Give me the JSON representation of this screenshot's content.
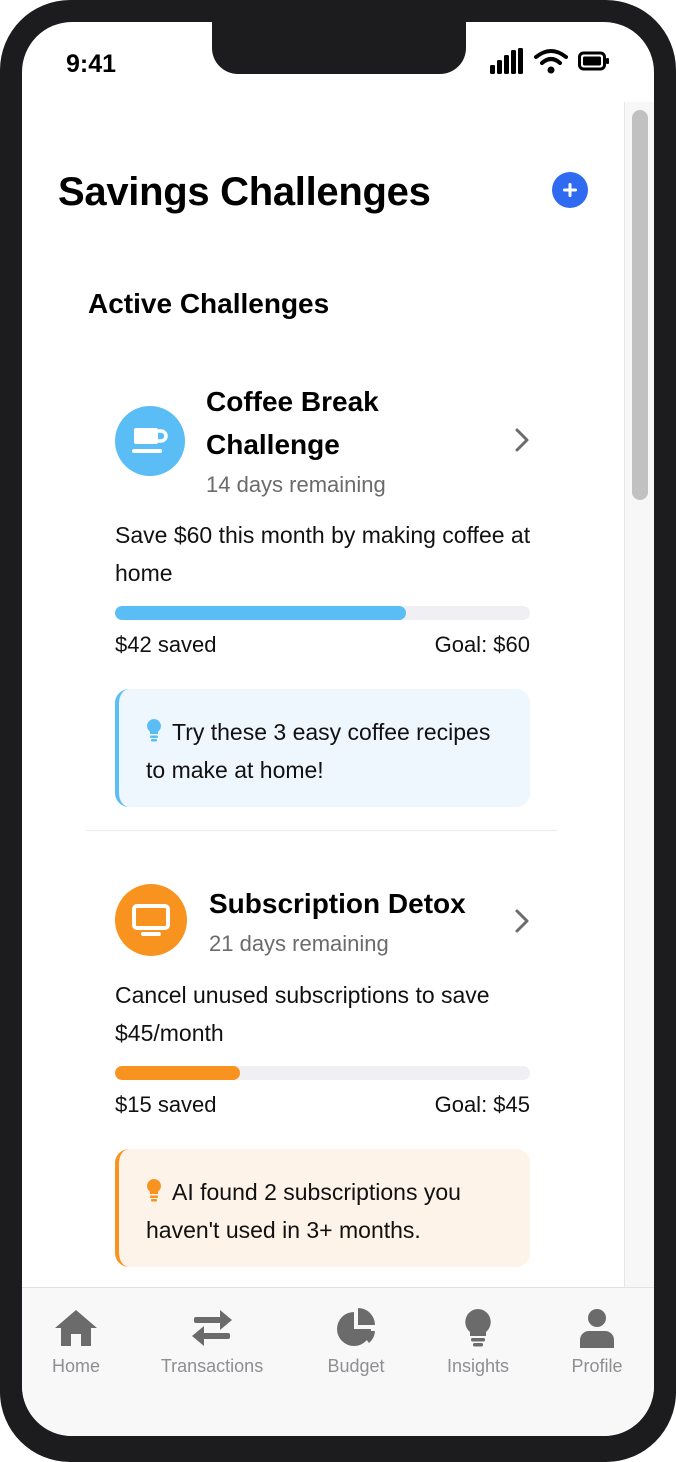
{
  "status_bar": {
    "time": "9:41"
  },
  "page": {
    "title": "Savings Challenges"
  },
  "section": {
    "title": "Active Challenges"
  },
  "challenges": [
    {
      "title_line1": "Coffee Break",
      "title_line2": "Challenge",
      "remaining": "14 days remaining",
      "description": "Save $60 this month by making coffee at home",
      "progress": 0.7,
      "saved": "$42 saved",
      "goal": "Goal: $60",
      "tip": "Try these 3 easy coffee recipes to make at home!",
      "icon": "coffee-cup-icon",
      "accent": "#5bbdf5",
      "tip_bg": "#eef6fe"
    },
    {
      "title_line1": "Subscription Detox",
      "remaining": "21 days remaining",
      "description": "Cancel unused subscriptions to save $45/month",
      "progress": 0.3,
      "saved": "$15 saved",
      "goal": "Goal: $45",
      "tip": "AI found 2 subscriptions you haven't used in 3+ months.",
      "icon": "monitor-icon",
      "accent": "#f7931e",
      "tip_bg": "#fdf3e8"
    }
  ],
  "tabs": [
    {
      "label": "Home",
      "icon": "home-icon"
    },
    {
      "label": "Transactions",
      "icon": "transfer-arrows-icon"
    },
    {
      "label": "Budget",
      "icon": "pie-chart-icon"
    },
    {
      "label": "Insights",
      "icon": "lightbulb-icon"
    },
    {
      "label": "Profile",
      "icon": "person-icon"
    }
  ],
  "colors": {
    "primary": "#2e6bf0",
    "tab_inactive": "#8e8e93"
  }
}
